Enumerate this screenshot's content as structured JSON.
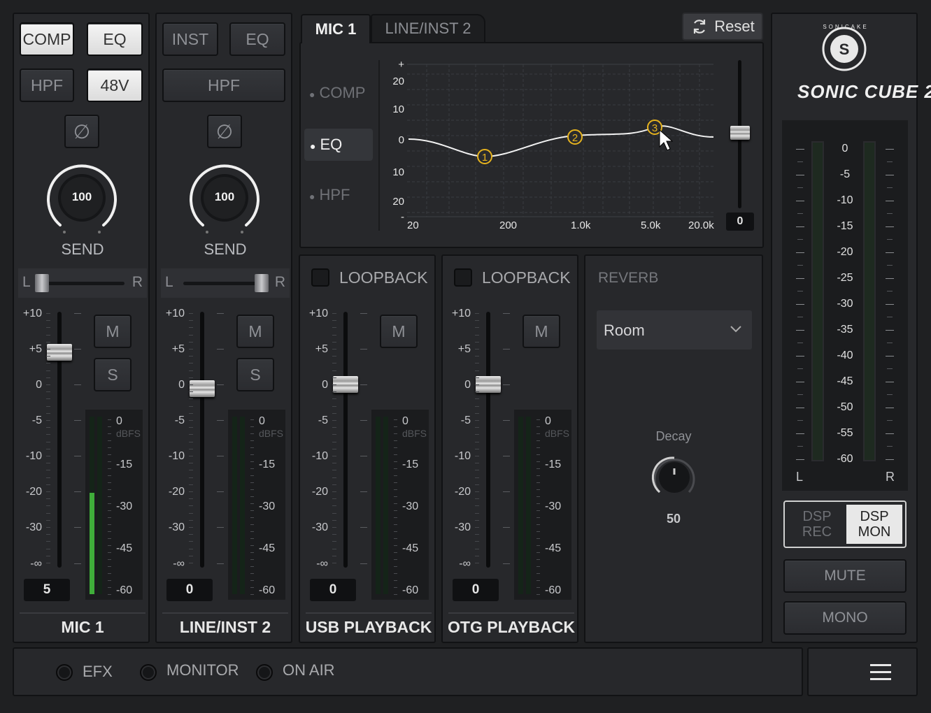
{
  "channels": [
    {
      "name": "MIC 1",
      "btn_a": "COMP",
      "btn_b": "EQ",
      "btn_c": "HPF",
      "btn_d": "48V",
      "phase_symbol": "∅",
      "send_value": "100",
      "send_label": "SEND",
      "pan_l": "L",
      "pan_r": "R",
      "mute": "M",
      "solo": "S",
      "fader_value": "5",
      "level_fraction": 0.57
    },
    {
      "name": "LINE/INST 2",
      "btn_a": "INST",
      "btn_b": "EQ",
      "btn_c": "HPF",
      "phase_symbol": "∅",
      "send_value": "100",
      "send_label": "SEND",
      "pan_l": "L",
      "pan_r": "R",
      "mute": "M",
      "solo": "S",
      "fader_value": "0",
      "level_fraction": 0
    },
    {
      "name": "USB PLAYBACK",
      "loopback": "LOOPBACK",
      "mute": "M",
      "fader_value": "0",
      "level_fraction": 0
    },
    {
      "name": "OTG PLAYBACK",
      "loopback": "LOOPBACK",
      "mute": "M",
      "fader_value": "0",
      "level_fraction": 0
    }
  ],
  "fader_scale": [
    "+10",
    "+5",
    "0",
    "-5",
    "-10",
    "-20",
    "-30",
    "-∞"
  ],
  "meter_scale": [
    "0",
    "dBFS",
    "-15",
    "-30",
    "-45",
    "-60"
  ],
  "eq_panel": {
    "tabs": [
      "MIC 1",
      "LINE/INST 2"
    ],
    "reset": "Reset",
    "menu": [
      "COMP",
      "EQ",
      "HPF"
    ],
    "active_menu": "EQ",
    "y_ticks": [
      "+",
      "20",
      "10",
      "0",
      "10",
      "20",
      "-"
    ],
    "x_ticks": [
      "20",
      "200",
      "1.0k",
      "5.0k",
      "20.0k"
    ],
    "bands": [
      "1",
      "2",
      "3"
    ],
    "gain_value": "0"
  },
  "reverb": {
    "title": "REVERB",
    "preset": "Room",
    "decay_label": "Decay",
    "decay_value": "50"
  },
  "master": {
    "brand": "SONICAKE",
    "product": "SONIC CUBE 2",
    "scale": [
      "0",
      "-5",
      "-10",
      "-15",
      "-20",
      "-25",
      "-30",
      "-35",
      "-40",
      "-45",
      "-50",
      "-55",
      "-60"
    ],
    "l": "L",
    "r": "R",
    "dsp_rec": "DSP REC",
    "dsp_mon": "DSP MON",
    "mute": "MUTE",
    "mono": "MONO"
  },
  "footer": {
    "efx": "EFX",
    "monitor": "MONITOR",
    "on_air": "ON AIR"
  },
  "colors": {
    "accent_green": "#3fae3a",
    "eq_node": "#e6b31e"
  }
}
